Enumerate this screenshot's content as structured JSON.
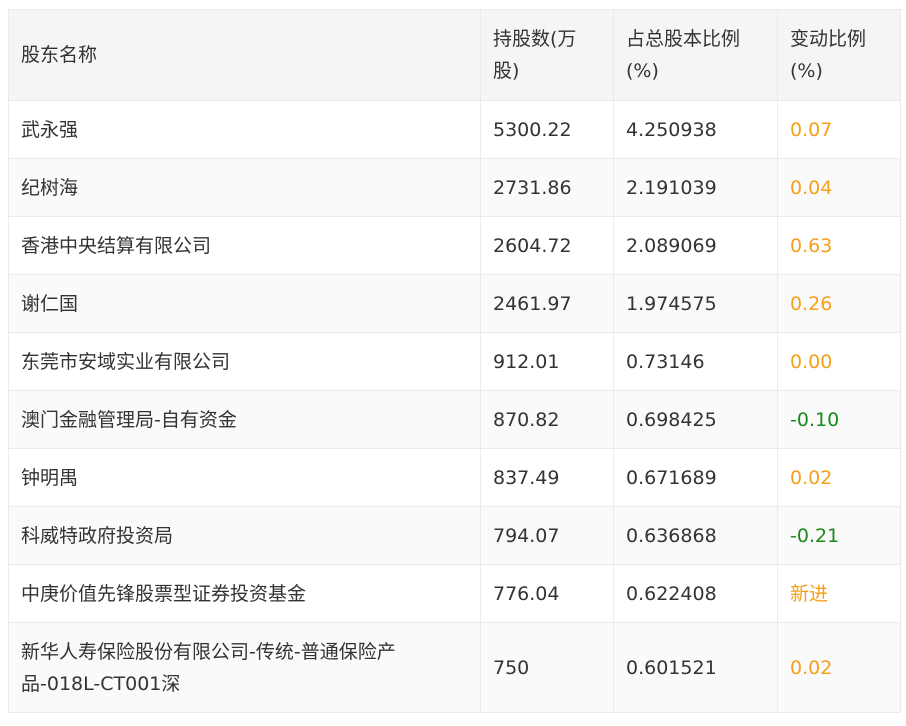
{
  "headers": {
    "name": "股东名称",
    "shares": "持股数(万股)",
    "ratio": "占总股本比例(%)",
    "change": "变动比例(%)"
  },
  "rows": [
    {
      "name": "武永强",
      "shares": "5300.22",
      "ratio": "4.250938",
      "change": "0.07",
      "change_type": "up"
    },
    {
      "name": "纪树海",
      "shares": "2731.86",
      "ratio": "2.191039",
      "change": "0.04",
      "change_type": "up"
    },
    {
      "name": "香港中央结算有限公司",
      "shares": "2604.72",
      "ratio": "2.089069",
      "change": "0.63",
      "change_type": "up"
    },
    {
      "name": "谢仁国",
      "shares": "2461.97",
      "ratio": "1.974575",
      "change": "0.26",
      "change_type": "up"
    },
    {
      "name": "东莞市安域实业有限公司",
      "shares": "912.01",
      "ratio": "0.73146",
      "change": "0.00",
      "change_type": "up"
    },
    {
      "name": "澳门金融管理局-自有资金",
      "shares": "870.82",
      "ratio": "0.698425",
      "change": "-0.10",
      "change_type": "down"
    },
    {
      "name": "钟明禺",
      "shares": "837.49",
      "ratio": "0.671689",
      "change": "0.02",
      "change_type": "up"
    },
    {
      "name": "科威特政府投资局",
      "shares": "794.07",
      "ratio": "0.636868",
      "change": "-0.21",
      "change_type": "down"
    },
    {
      "name": "中庚价值先锋股票型证券投资基金",
      "shares": "776.04",
      "ratio": "0.622408",
      "change": "新进",
      "change_type": "new"
    },
    {
      "name": "新华人寿保险股份有限公司-传统-普通保险产品-018L-CT001深",
      "shares": "750",
      "ratio": "0.601521",
      "change": "0.02",
      "change_type": "up"
    }
  ],
  "colors": {
    "positive": "#f5a01a",
    "negative": "#1a8a1a",
    "new": "#f5a01a",
    "header_bg": "#f5f5f5",
    "border": "#ebebeb"
  }
}
